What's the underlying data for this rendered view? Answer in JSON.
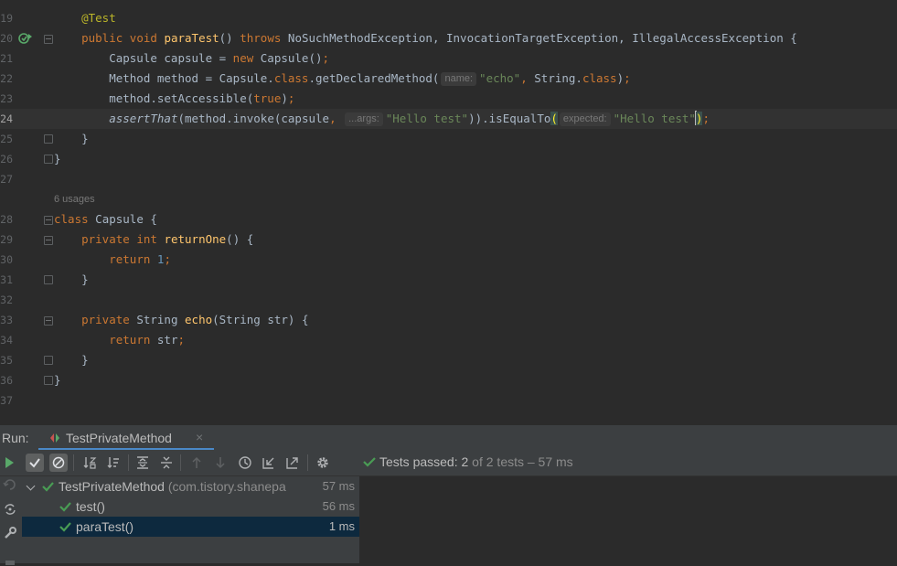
{
  "editor": {
    "lines": [
      {
        "num": "19",
        "tokens": [
          {
            "t": "    "
          },
          {
            "t": "@Test",
            "c": "ann"
          }
        ]
      },
      {
        "num": "20",
        "tokens": [
          {
            "t": "    "
          },
          {
            "t": "public",
            "c": "kw"
          },
          {
            "t": " "
          },
          {
            "t": "void",
            "c": "kw"
          },
          {
            "t": " "
          },
          {
            "t": "paraTest",
            "c": "fn"
          },
          {
            "t": "() "
          },
          {
            "t": "throws",
            "c": "kw"
          },
          {
            "t": " NoSuchMethodException, InvocationTargetException, IllegalAccessException {"
          }
        ]
      },
      {
        "num": "21",
        "tokens": [
          {
            "t": "        Capsule capsule = "
          },
          {
            "t": "new",
            "c": "kw"
          },
          {
            "t": " Capsule()"
          },
          {
            "t": ";",
            "c": "kw"
          }
        ]
      },
      {
        "num": "22",
        "tokens": [
          {
            "t": "        Method method = Capsule."
          },
          {
            "t": "class",
            "c": "kw"
          },
          {
            "t": ".getDeclaredMethod("
          },
          {
            "hint": "name:"
          },
          {
            "t": "\"echo\"",
            "c": "str"
          },
          {
            "t": ", ",
            "c": "kw"
          },
          {
            "t": "String."
          },
          {
            "t": "class",
            "c": "kw"
          },
          {
            "t": ")"
          },
          {
            "t": ";",
            "c": "kw"
          }
        ]
      },
      {
        "num": "23",
        "tokens": [
          {
            "t": "        method.setAccessible("
          },
          {
            "t": "true",
            "c": "kw"
          },
          {
            "t": ")"
          },
          {
            "t": ";",
            "c": "kw"
          }
        ]
      },
      {
        "num": "24",
        "current": true,
        "tokens": [
          {
            "t": "        "
          },
          {
            "t": "assertThat",
            "c": "it"
          },
          {
            "t": "(method.invoke(capsule"
          },
          {
            "t": ", ",
            "c": "kw"
          },
          {
            "hint": "...args:"
          },
          {
            "t": "\"Hello test\"",
            "c": "str"
          },
          {
            "t": ")).isEqualTo"
          },
          {
            "t": "(",
            "c": "bracehl"
          },
          {
            "hint": "expected:"
          },
          {
            "t": "\"Hello test\"",
            "c": "str"
          },
          {
            "caret": true
          },
          {
            "t": ")",
            "c": "bracehl"
          },
          {
            "t": ";",
            "c": "kw"
          }
        ]
      },
      {
        "num": "25",
        "tokens": [
          {
            "t": "    }"
          }
        ]
      },
      {
        "num": "26",
        "tokens": [
          {
            "t": "}"
          }
        ]
      },
      {
        "num": "27",
        "tokens": []
      },
      {
        "num": "28",
        "tokens": [
          {
            "t": "class",
            "c": "kw"
          },
          {
            "t": " Capsule {"
          }
        ],
        "usages": "6 usages"
      },
      {
        "num": "29",
        "tokens": [
          {
            "t": "    "
          },
          {
            "t": "private",
            "c": "kw"
          },
          {
            "t": " "
          },
          {
            "t": "int",
            "c": "kw"
          },
          {
            "t": " "
          },
          {
            "t": "returnOne",
            "c": "fn"
          },
          {
            "t": "() {"
          }
        ]
      },
      {
        "num": "30",
        "tokens": [
          {
            "t": "        "
          },
          {
            "t": "return",
            "c": "kw"
          },
          {
            "t": " "
          },
          {
            "t": "1",
            "c": "num"
          },
          {
            "t": ";",
            "c": "kw"
          }
        ]
      },
      {
        "num": "31",
        "tokens": [
          {
            "t": "    }"
          }
        ]
      },
      {
        "num": "32",
        "tokens": []
      },
      {
        "num": "33",
        "tokens": [
          {
            "t": "    "
          },
          {
            "t": "private",
            "c": "kw"
          },
          {
            "t": " String "
          },
          {
            "t": "echo",
            "c": "fn"
          },
          {
            "t": "(String str) {"
          }
        ]
      },
      {
        "num": "34",
        "tokens": [
          {
            "t": "        "
          },
          {
            "t": "return",
            "c": "kw"
          },
          {
            "t": " str"
          },
          {
            "t": ";",
            "c": "kw"
          }
        ]
      },
      {
        "num": "35",
        "tokens": [
          {
            "t": "    }"
          }
        ]
      },
      {
        "num": "36",
        "tokens": [
          {
            "t": "}"
          }
        ]
      },
      {
        "num": "37",
        "tokens": []
      }
    ]
  },
  "run": {
    "label": "Run:",
    "tab_label": "TestPrivateMethod",
    "tab_close": "×",
    "status_prefix": "Tests passed: ",
    "status_passed": "2",
    "status_rest": " of 2 tests – 57 ms",
    "tree": [
      {
        "name": "TestPrivateMethod",
        "pkg": "(com.tistory.shanepa",
        "time": "57 ms"
      },
      {
        "name": "test()",
        "time": "56 ms"
      },
      {
        "name": "paraTest()",
        "time": "1 ms"
      }
    ]
  },
  "colors": {
    "accent": "#4a88c7",
    "pass": "#499c54",
    "run": "#59a869",
    "selection": "#0d293e"
  }
}
